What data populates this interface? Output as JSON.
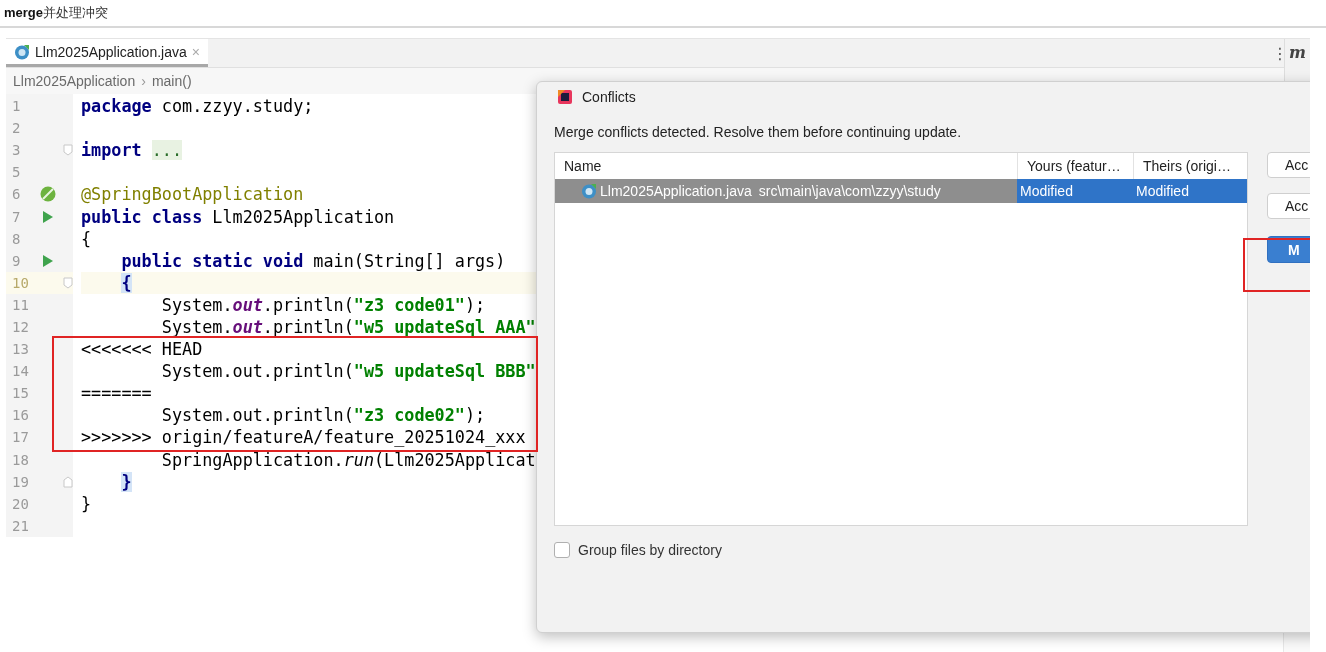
{
  "page_title": "**merge**并处理冲突",
  "editor": {
    "tabs": [
      {
        "label": "Llm2025Application.java",
        "close": "×",
        "selected": true
      }
    ],
    "breadcrumb": [
      "Llm2025Application",
      "main()"
    ],
    "breadcrumb_separator": "›",
    "toolbar": {
      "menu": "⋮",
      "side_label": "m"
    },
    "lines": [
      {
        "number": "1",
        "kind": "top",
        "current": false,
        "tokens": [
          {
            "kind": "keyword",
            "text": "package"
          },
          {
            "kind": "plain",
            "text": " com.zzyy.study;"
          }
        ]
      },
      {
        "number": "2",
        "kind": "top",
        "current": false
      },
      {
        "number": "3",
        "kind": "top",
        "current": false,
        "fold": {
          "kind": "open"
        },
        "tokens": [
          {
            "kind": "keyword",
            "text": "import"
          },
          {
            "kind": "folded",
            "text": "..."
          }
        ]
      },
      {
        "number": "5",
        "kind": "top",
        "current": false
      },
      {
        "number": "6",
        "kind": "top",
        "current": false,
        "gutter": {
          "kind": "spring"
        },
        "tokens": [
          {
            "kind": "annotation",
            "text": "@SpringBootApplication"
          }
        ]
      },
      {
        "number": "7",
        "kind": "top",
        "current": false,
        "gutter": {
          "kind": "run"
        },
        "tokens": [
          {
            "kind": "keyword",
            "text": "public class"
          },
          {
            "kind": "plain",
            "text": " Llm2025Application"
          }
        ]
      },
      {
        "number": "8",
        "kind": "top",
        "current": false,
        "tokens": [
          {
            "kind": "plain",
            "text": "{"
          }
        ]
      },
      {
        "number": "9",
        "kind": "member",
        "current": false,
        "gutter": {
          "kind": "run"
        },
        "tokens": [
          {
            "kind": "keyword",
            "text": "public static void"
          },
          {
            "kind": "plain",
            "text": " main(String[] args)"
          }
        ]
      },
      {
        "number": "10",
        "kind": "member",
        "current": true,
        "fold": {
          "kind": "open"
        },
        "tokens": [
          {
            "kind": "brace",
            "text": "{"
          }
        ]
      },
      {
        "number": "11",
        "kind": "statement",
        "current": false,
        "tokens": [
          {
            "kind": "plain",
            "text": "System."
          },
          {
            "kind": "static",
            "text": "out"
          },
          {
            "kind": "plain",
            "text": ".println("
          },
          {
            "kind": "string",
            "text": "\"z3 code01\""
          },
          {
            "kind": "plain",
            "text": ");"
          }
        ]
      },
      {
        "number": "12",
        "kind": "statement",
        "current": false,
        "tokens": [
          {
            "kind": "plain",
            "text": "System."
          },
          {
            "kind": "static",
            "text": "out"
          },
          {
            "kind": "plain",
            "text": ".println("
          },
          {
            "kind": "string",
            "text": "\"w5 updateSql AAA\""
          }
        ]
      },
      {
        "number": "13",
        "kind": "top",
        "current": false,
        "tokens": [
          {
            "kind": "plain",
            "text": "<<<<<<< HEAD"
          }
        ]
      },
      {
        "number": "14",
        "kind": "statement",
        "current": false,
        "tokens": [
          {
            "kind": "plain",
            "text": "System.out.println("
          },
          {
            "kind": "string",
            "text": "\"w5 updateSql BBB\""
          }
        ]
      },
      {
        "number": "15",
        "kind": "top",
        "current": false,
        "tokens": [
          {
            "kind": "plain",
            "text": "======="
          }
        ]
      },
      {
        "number": "16",
        "kind": "statement",
        "current": false,
        "tokens": [
          {
            "kind": "plain",
            "text": "System.out.println("
          },
          {
            "kind": "string",
            "text": "\"z3 code02\""
          },
          {
            "kind": "plain",
            "text": ");"
          }
        ]
      },
      {
        "number": "17",
        "kind": "top",
        "current": false,
        "tokens": [
          {
            "kind": "plain",
            "text": ">>>>>>> origin/featureA/feature_20251024_xxx"
          }
        ]
      },
      {
        "number": "18",
        "kind": "statement",
        "current": false,
        "tokens": [
          {
            "kind": "plain",
            "text": "SpringApplication."
          },
          {
            "kind": "static-call",
            "text": "run"
          },
          {
            "kind": "plain",
            "text": "(Llm2025Applicat"
          }
        ]
      },
      {
        "number": "19",
        "kind": "member",
        "current": false,
        "fold": {
          "kind": "close"
        },
        "tokens": [
          {
            "kind": "brace",
            "text": "}"
          }
        ]
      },
      {
        "number": "20",
        "kind": "top",
        "current": false,
        "tokens": [
          {
            "kind": "plain",
            "text": "}"
          }
        ]
      },
      {
        "number": "21",
        "kind": "top",
        "current": false
      }
    ]
  },
  "dialog": {
    "title": "Conflicts",
    "message": "Merge conflicts detected. Resolve them before continuing update.",
    "table": {
      "columns": [
        "Name",
        "Yours (featur…",
        "Theirs (origi…"
      ],
      "rows": [
        {
          "file": "Llm2025Application.java",
          "path": "src\\main\\java\\com\\zzyy\\study",
          "yours": "Modified",
          "theirs": "Modified",
          "selected": true
        }
      ]
    },
    "buttons": [
      {
        "label": "Acc",
        "kind": "default"
      },
      {
        "label": "Acc",
        "kind": "default"
      },
      {
        "label": "M",
        "kind": "primary"
      }
    ],
    "group_by_directory": {
      "label": "Group files by directory",
      "checked": false
    }
  }
}
